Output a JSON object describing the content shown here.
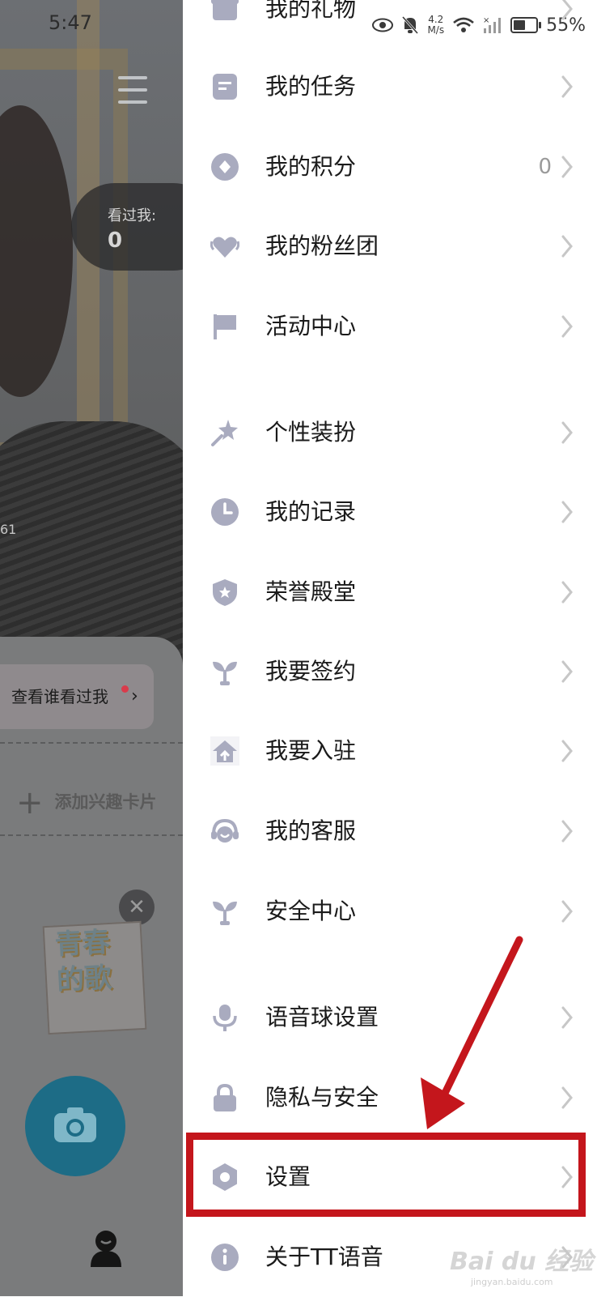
{
  "background": {
    "time": "5:47",
    "seen_label": "看过我:",
    "seen_count": "0",
    "side_number": "61",
    "seen_button": "查看谁看过我",
    "add_interest_card": "添加兴趣卡片",
    "sticker_text": [
      "青春",
      "的歌"
    ]
  },
  "status_bar": {
    "net_speed_value": "4.2",
    "net_speed_unit": "M/s",
    "battery": "55%"
  },
  "menu": {
    "items": [
      {
        "label": "我的礼物",
        "icon": "gift-box-icon"
      },
      {
        "label": "我的任务",
        "icon": "task-list-icon"
      },
      {
        "label": "我的积分",
        "icon": "points-coin-icon",
        "value": "0"
      },
      {
        "label": "我的粉丝团",
        "icon": "fan-club-heart-icon"
      },
      {
        "label": "活动中心",
        "icon": "flag-icon"
      },
      {
        "label": "个性装扮",
        "icon": "wand-star-icon"
      },
      {
        "label": "我的记录",
        "icon": "clock-icon"
      },
      {
        "label": "荣誉殿堂",
        "icon": "shield-star-icon"
      },
      {
        "label": "我要签约",
        "icon": "sprout-icon"
      },
      {
        "label": "我要入驻",
        "icon": "house-arrow-icon"
      },
      {
        "label": "我的客服",
        "icon": "headset-icon"
      },
      {
        "label": "安全中心",
        "icon": "sprout-icon"
      },
      {
        "label": "语音球设置",
        "icon": "microphone-icon"
      },
      {
        "label": "隐私与安全",
        "icon": "lock-icon"
      },
      {
        "label": "设置",
        "icon": "gear-hexagon-icon"
      },
      {
        "label": "关于TT语音",
        "icon": "info-icon"
      }
    ]
  },
  "watermark": {
    "brand": "Bai du 经验",
    "url": "jingyan.baidu.com"
  },
  "colors": {
    "icon": "#a9abbf",
    "highlight": "#c4161c",
    "chevron": "#c7c7c7"
  }
}
